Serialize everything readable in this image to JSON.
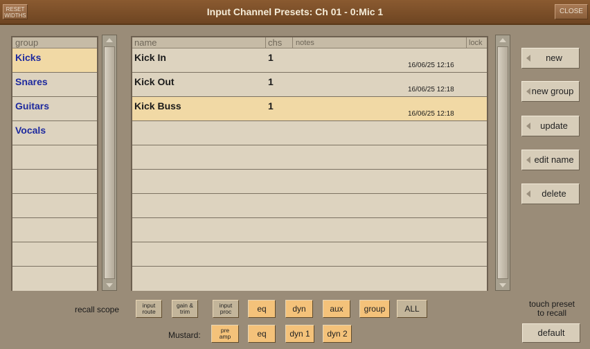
{
  "window": {
    "title": "Input Channel Presets: Ch 01 - 0:Mic 1",
    "reset_widths_line1": "RESET",
    "reset_widths_line2": "WIDTHS",
    "close_label": "CLOSE"
  },
  "groups": {
    "header": "group",
    "items": [
      "Kicks",
      "Snares",
      "Guitars",
      "Vocals"
    ],
    "selected": "Kicks"
  },
  "presets": {
    "columns": {
      "name": "name",
      "chs": "chs",
      "notes": "notes",
      "lock": "lock"
    },
    "rows": [
      {
        "name": "Kick In",
        "chs": "1",
        "date": "16/06/25 12:16"
      },
      {
        "name": "Kick Out",
        "chs": "1",
        "date": "16/06/25 12:18"
      },
      {
        "name": "Kick Buss",
        "chs": "1",
        "date": "16/06/25 12:18"
      }
    ],
    "selected": "Kick Buss"
  },
  "actions": {
    "new": "new",
    "new_group": "new group",
    "update": "update",
    "edit_name": "edit name",
    "delete": "delete",
    "default": "default"
  },
  "recall_scope": {
    "label": "recall scope",
    "input_route": [
      "input",
      "route"
    ],
    "gain_trim": [
      "gain &",
      "trim"
    ],
    "input_proc": [
      "input",
      "proc"
    ],
    "eq": "eq",
    "dyn": "dyn",
    "aux": "aux",
    "group": "group",
    "all": "ALL"
  },
  "mustard": {
    "label": "Mustard:",
    "pre_amp": [
      "pre",
      "amp"
    ],
    "eq": "eq",
    "dyn1": "dyn 1",
    "dyn2": "dyn 2"
  },
  "hint": {
    "line1": "touch preset",
    "line2": "to recall"
  },
  "colors": {
    "titlebar": "#6e4522",
    "background": "#9a8c78",
    "panel": "#ddd3bf",
    "selected_row": "#f1d9a5",
    "group_text": "#1e2a9e",
    "orange_button": "#f4c27a"
  }
}
